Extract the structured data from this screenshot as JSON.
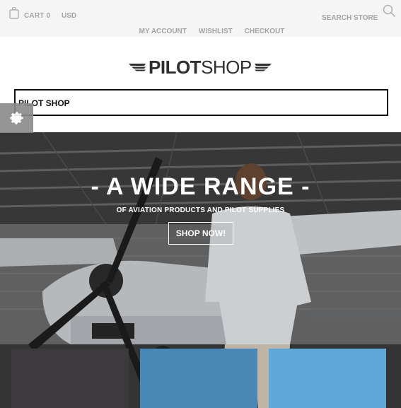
{
  "topbar": {
    "cart_label": "CART 0",
    "currency": "USD",
    "search_label": "SEARCH STORE",
    "icons": {
      "cart": "shopping-bag-icon",
      "search": "search-icon"
    }
  },
  "account_nav": {
    "items": [
      {
        "label": "MY ACCOUNT"
      },
      {
        "label": "WISHLIST"
      },
      {
        "label": "CHECKOUT"
      }
    ]
  },
  "logo": {
    "text_bold": "PILOT",
    "text_light": "SHOP"
  },
  "store_select": {
    "value": "PILOT SHOP"
  },
  "settings": {
    "icon": "gear-icon"
  },
  "hero": {
    "title": "- A WIDE RANGE -",
    "subtitle": "OF AVIATION PRODUCTS AND PILOT SUPPLIES",
    "cta_label": "SHOP NOW!"
  },
  "tiles": {
    "colors": [
      "#3c3a3c",
      "#4887b6",
      "#5ea8d8"
    ]
  },
  "colors": {
    "topbar_bg": "#f5f5f5",
    "muted_text": "#a3a3a3",
    "logo_text": "#2f2f2f"
  }
}
